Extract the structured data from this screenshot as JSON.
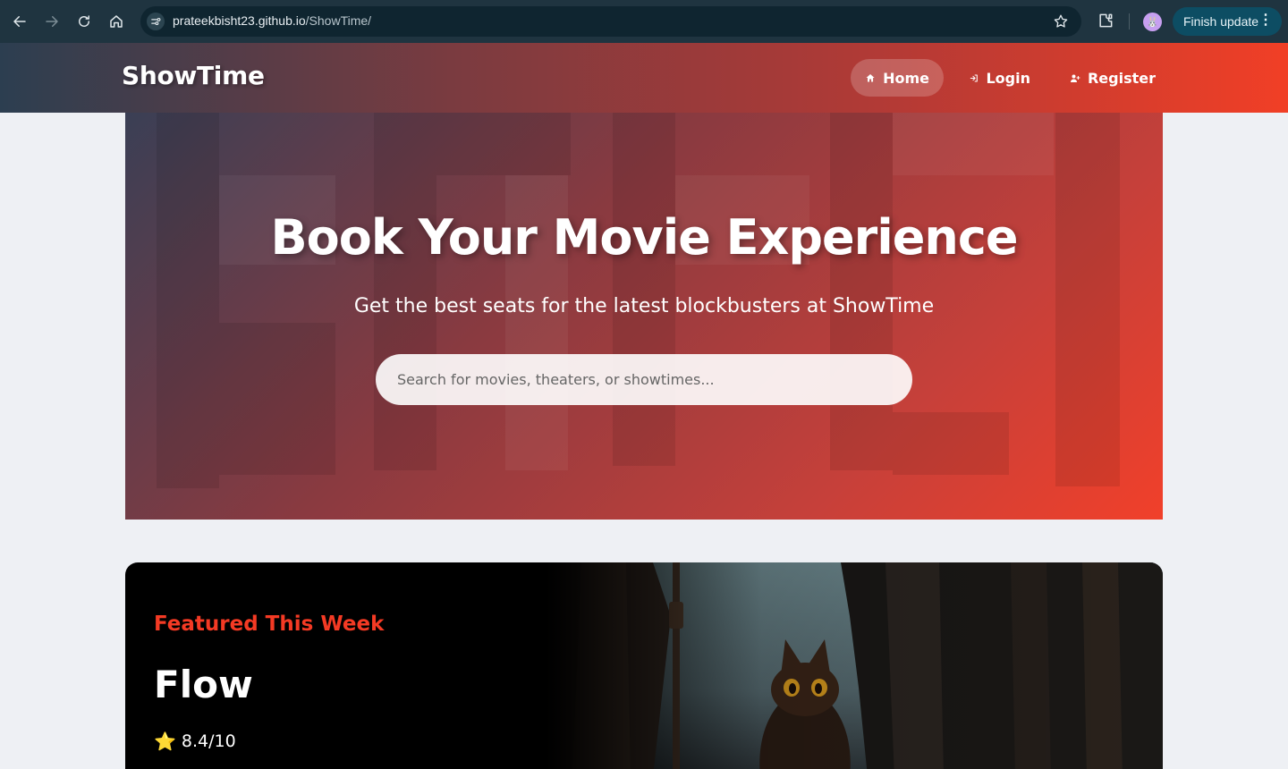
{
  "browser": {
    "url_host": "prateekbisht23.github.io",
    "url_path": "/ShowTime/",
    "finish_update_label": "Finish update",
    "profile_avatar": "🐰"
  },
  "navbar": {
    "brand": "ShowTime",
    "links": [
      {
        "label": "Home",
        "icon": "home-icon"
      },
      {
        "label": "Login",
        "icon": "login-icon"
      },
      {
        "label": "Register",
        "icon": "user-plus-icon"
      }
    ]
  },
  "hero": {
    "title": "Book Your Movie Experience",
    "subtitle": "Get the best seats for the latest blockbusters at ShowTime",
    "search_placeholder": "Search for movies, theaters, or showtimes..."
  },
  "featured": {
    "label": "Featured This Week",
    "title": "Flow",
    "rating_icon": "⭐",
    "rating": "8.4/10"
  },
  "colors": {
    "accent": "#f13f26",
    "navbar_start": "#2c3e50",
    "chrome_bg": "#1f3440"
  }
}
